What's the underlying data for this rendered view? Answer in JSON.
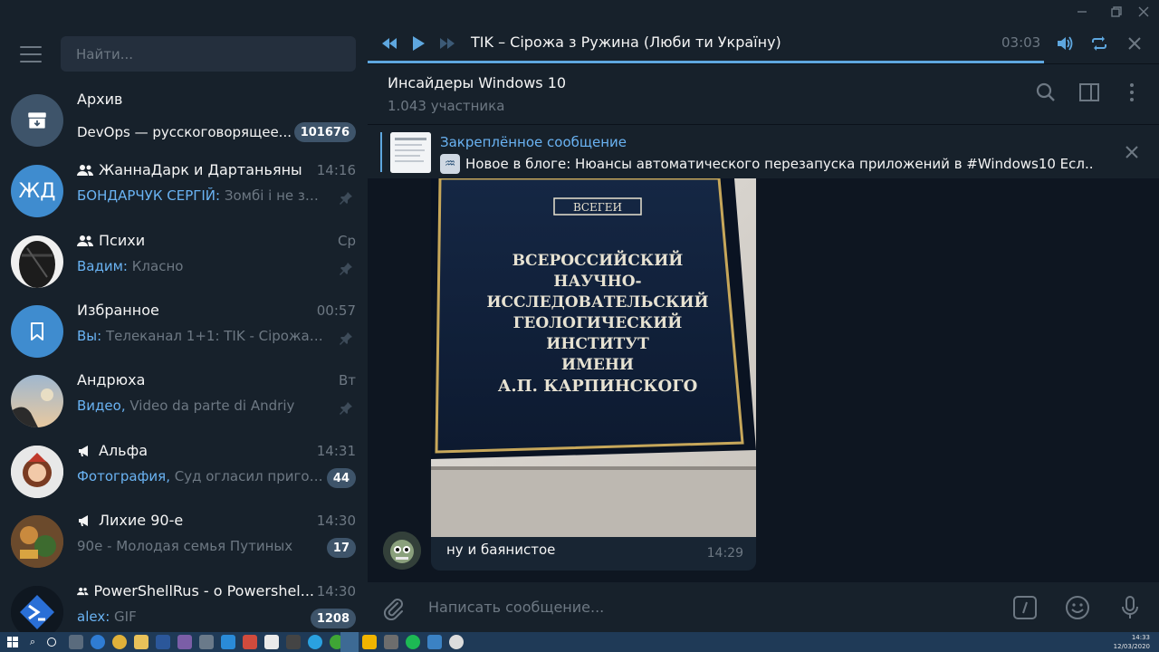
{
  "search": {
    "placeholder": "Найти..."
  },
  "chats": [
    {
      "name": "Архив",
      "preview_text": "DevOps — русскоговорящее...",
      "badge": "101676",
      "avatar_icon": "archive-icon",
      "avatar_color": "#3e546a"
    },
    {
      "name": "ЖаннаДарк и Дартаньяны",
      "time": "14:16",
      "sender": "БОНДАРЧУК СЕРГІЙ:",
      "preview_text": "Зомбі і не зн...",
      "avatar_text": "ЖД",
      "avatar_color": "#3f8ccf",
      "group": true,
      "pinned": true
    },
    {
      "name": "Психи",
      "time": "Ср",
      "sender": "Вадим:",
      "preview_text": "Класно",
      "group": true,
      "pinned": true
    },
    {
      "name": "Избранное",
      "time": "00:57",
      "sender": "Вы:",
      "preview_text": "Телеканал 1+1: TIK - Сірожа з ...",
      "avatar_icon": "bookmark-icon",
      "avatar_color": "#3f8ccf",
      "pinned": true
    },
    {
      "name": "Андрюха",
      "time": "Вт",
      "sender": "Видео,",
      "preview_text": "Video da parte di Andriy",
      "pinned": true
    },
    {
      "name": "Альфа",
      "time": "14:31",
      "sender": "Фотография,",
      "preview_text": "Суд огласил пригов...",
      "badge": "44",
      "channel": true
    },
    {
      "name": "Лихие 90-е",
      "time": "14:30",
      "preview_text": "90е - Молодая семья Путиных",
      "badge": "17",
      "channel": true
    },
    {
      "name": "PowerShellRus - о Powershel...",
      "time": "14:30",
      "sender": "alex:",
      "preview_text": "GIF",
      "badge": "1208",
      "group": true
    }
  ],
  "player": {
    "track": "TIK – Сірожа з Ружина (Люби ти Україну)",
    "time": "03:03",
    "progress": 0.855
  },
  "chat_header": {
    "title": "Инсайдеры Windows 10",
    "members": "1.043 участника"
  },
  "pinned": {
    "title": "Закреплённое сообщение",
    "text": "Новое в блоге: Нюансы автоматического перезапуска приложений в #Windows10  Есл..."
  },
  "photo_sign": {
    "logo": "ВСЕГЕИ",
    "lines": [
      "ВСЕРОССИЙСКИЙ",
      "НАУЧНО-",
      "ИССЛЕДОВАТЕЛЬСКИЙ",
      "ГЕОЛОГИЧЕСКИЙ",
      "ИНСТИТУТ",
      "ИМЕНИ",
      "А.П. КАРПИНСКОГО"
    ]
  },
  "message": {
    "text": "ну и баянистое",
    "time": "14:29"
  },
  "compose": {
    "placeholder": "Написать сообщение..."
  },
  "taskbar": {
    "time": "14:33",
    "date": "12/03/2020"
  },
  "colors": {
    "accent": "#5ea7df",
    "sidebar_bg": "#17212b",
    "chat_bg": "#0e1621",
    "badge": "#3e546a"
  }
}
